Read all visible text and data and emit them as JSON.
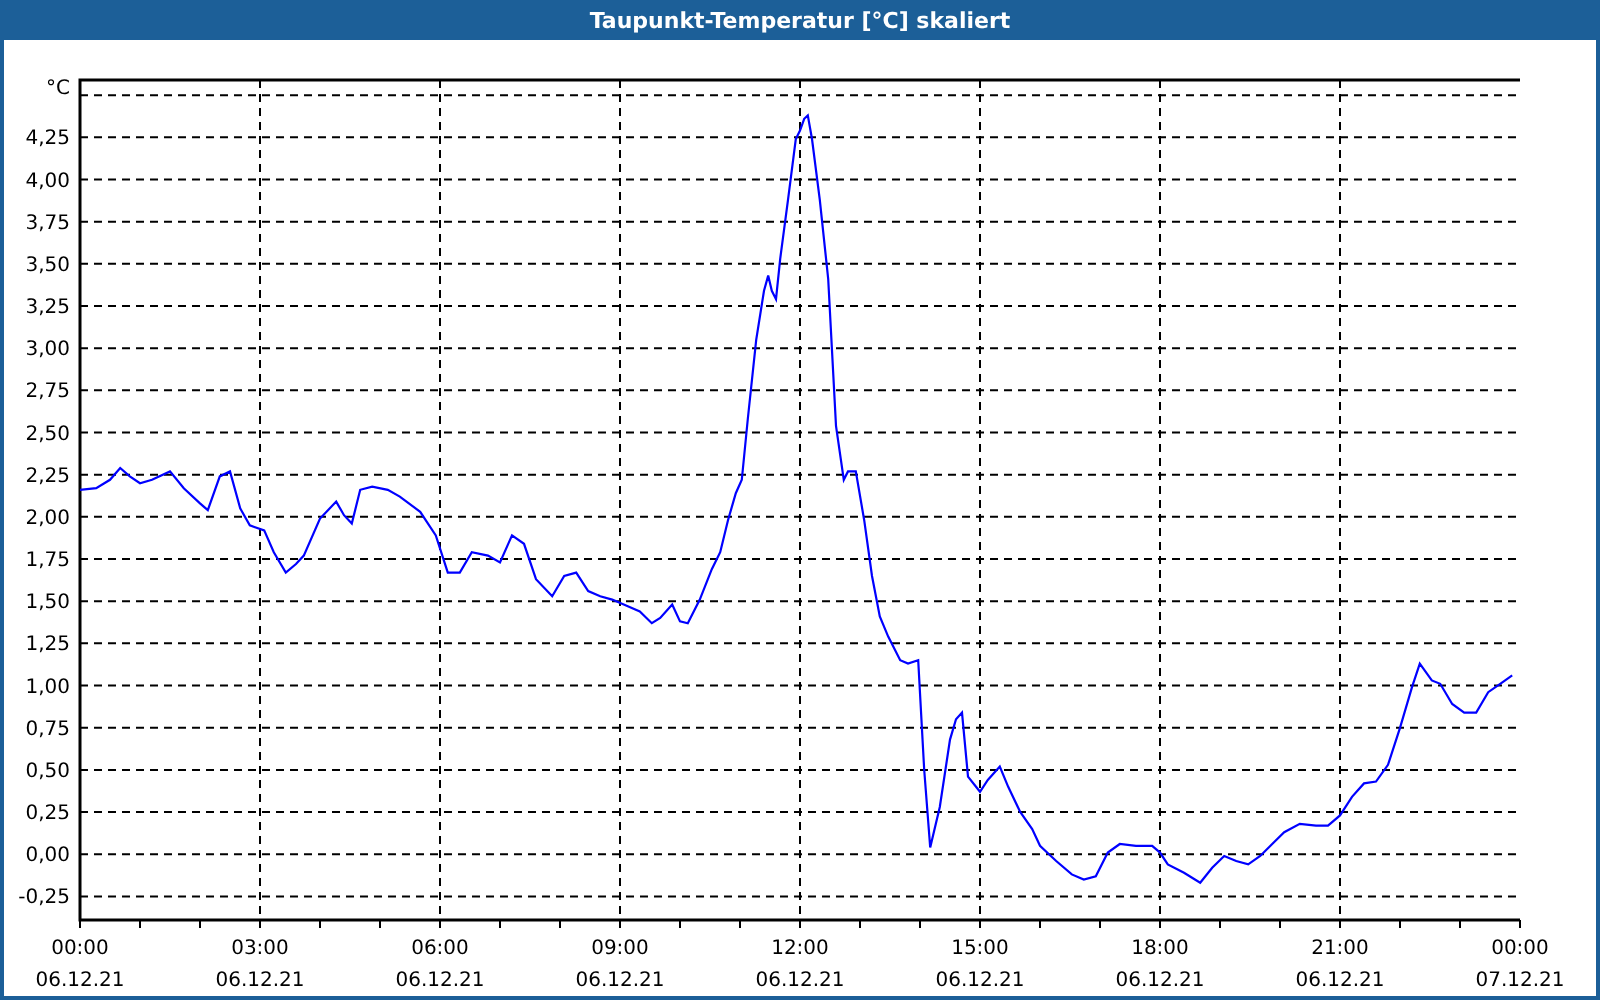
{
  "window": {
    "title": "Taupunkt-Temperatur [°C] skaliert"
  },
  "chart": {
    "x_dates": [
      "06.12.21",
      "06.12.21",
      "06.12.21",
      "06.12.21",
      "06.12.21",
      "06.12.21",
      "06.12.21",
      "06.12.21",
      "07.12.21"
    ],
    "chart_data": {
      "type": "line",
      "grid": true,
      "xlim": [
        0,
        24
      ],
      "ylim": [
        -0.39,
        4.59
      ],
      "yticks": [
        {
          "value": -0.25,
          "label": "-0,25"
        },
        {
          "value": 0,
          "label": "0,00"
        },
        {
          "value": 0.25,
          "label": "0,25"
        },
        {
          "value": 0.5,
          "label": "0,50"
        },
        {
          "value": 0.75,
          "label": "0,75"
        },
        {
          "value": 1,
          "label": "1,00"
        },
        {
          "value": 1.25,
          "label": "1,25"
        },
        {
          "value": 1.5,
          "label": "1,50"
        },
        {
          "value": 1.75,
          "label": "1,75"
        },
        {
          "value": 2,
          "label": "2,00"
        },
        {
          "value": 2.25,
          "label": "2,25"
        },
        {
          "value": 2.5,
          "label": "2,50"
        },
        {
          "value": 2.75,
          "label": "2,75"
        },
        {
          "value": 3,
          "label": "3,00"
        },
        {
          "value": 3.25,
          "label": "3,25"
        },
        {
          "value": 3.5,
          "label": "3,50"
        },
        {
          "value": 3.75,
          "label": "3,75"
        },
        {
          "value": 4,
          "label": "4,00"
        },
        {
          "value": 4.25,
          "label": "4,25"
        },
        {
          "value": 4.5,
          "label": "°C"
        }
      ],
      "xticks": [
        {
          "value": 0,
          "label": "00:00"
        },
        {
          "value": 3,
          "label": "03:00"
        },
        {
          "value": 6,
          "label": "06:00"
        },
        {
          "value": 9,
          "label": "09:00"
        },
        {
          "value": 12,
          "label": "12:00"
        },
        {
          "value": 15,
          "label": "15:00"
        },
        {
          "value": 18,
          "label": "18:00"
        },
        {
          "value": 21,
          "label": "21:00"
        },
        {
          "value": 24,
          "label": "00:00"
        }
      ],
      "x": [
        0,
        0.27,
        0.5,
        0.67,
        0.83,
        1,
        1.2,
        1.5,
        1.73,
        2,
        2.13,
        2.33,
        2.5,
        2.67,
        2.83,
        3.07,
        3.23,
        3.43,
        3.6,
        3.73,
        4,
        4.27,
        4.4,
        4.53,
        4.67,
        4.87,
        5.13,
        5.33,
        5.67,
        5.93,
        6.13,
        6.33,
        6.53,
        6.8,
        7,
        7.2,
        7.4,
        7.6,
        7.87,
        8.07,
        8.27,
        8.47,
        8.67,
        8.87,
        9.13,
        9.33,
        9.53,
        9.67,
        9.87,
        10,
        10.13,
        10.33,
        10.53,
        10.67,
        10.8,
        10.93,
        11.03,
        11.13,
        11.27,
        11.4,
        11.47,
        11.53,
        11.6,
        11.67,
        11.8,
        11.93,
        12,
        12.07,
        12.13,
        12.2,
        12.33,
        12.47,
        12.6,
        12.73,
        12.8,
        12.93,
        13.07,
        13.2,
        13.33,
        13.47,
        13.67,
        13.8,
        13.97,
        14.07,
        14.17,
        14.33,
        14.5,
        14.6,
        14.7,
        14.8,
        15,
        15.13,
        15.33,
        15.47,
        15.67,
        15.87,
        16,
        16.27,
        16.53,
        16.73,
        16.93,
        17.13,
        17.33,
        17.6,
        17.87,
        18,
        18.13,
        18.4,
        18.67,
        18.87,
        19.07,
        19.27,
        19.47,
        19.67,
        19.87,
        20.07,
        20.33,
        20.6,
        20.8,
        21,
        21.2,
        21.4,
        21.6,
        21.8,
        22,
        22.2,
        22.33,
        22.53,
        22.67,
        22.87,
        23.07,
        23.27,
        23.47,
        23.67,
        23.87
      ],
      "series": [
        {
          "color": "#0000ff",
          "values": [
            2.16,
            2.17,
            2.22,
            2.29,
            2.24,
            2.2,
            2.22,
            2.27,
            2.17,
            2.08,
            2.04,
            2.24,
            2.27,
            2.05,
            1.95,
            1.92,
            1.79,
            1.67,
            1.72,
            1.77,
            1.99,
            2.09,
            2.01,
            1.96,
            2.16,
            2.18,
            2.16,
            2.12,
            2.03,
            1.89,
            1.67,
            1.67,
            1.79,
            1.77,
            1.73,
            1.89,
            1.84,
            1.63,
            1.53,
            1.65,
            1.67,
            1.56,
            1.53,
            1.51,
            1.47,
            1.44,
            1.37,
            1.4,
            1.48,
            1.38,
            1.37,
            1.51,
            1.69,
            1.79,
            1.98,
            2.14,
            2.22,
            2.58,
            3.05,
            3.34,
            3.43,
            3.34,
            3.29,
            3.53,
            3.88,
            4.24,
            4.29,
            4.36,
            4.38,
            4.24,
            3.88,
            3.41,
            2.54,
            2.22,
            2.27,
            2.27,
            1.98,
            1.65,
            1.41,
            1.29,
            1.15,
            1.13,
            1.15,
            0.5,
            0.04,
            0.28,
            0.68,
            0.8,
            0.84,
            0.46,
            0.37,
            0.44,
            0.52,
            0.4,
            0.25,
            0.15,
            0.05,
            -0.04,
            -0.12,
            -0.15,
            -0.13,
            0.01,
            0.06,
            0.05,
            0.05,
            0.01,
            -0.06,
            -0.11,
            -0.17,
            -0.08,
            -0.01,
            -0.04,
            -0.06,
            -0.01,
            0.06,
            0.13,
            0.18,
            0.17,
            0.17,
            0.23,
            0.34,
            0.42,
            0.43,
            0.53,
            0.75,
            0.99,
            1.13,
            1.03,
            1.01,
            0.89,
            0.84,
            0.84,
            0.96,
            1.01,
            1.06
          ]
        }
      ]
    }
  }
}
